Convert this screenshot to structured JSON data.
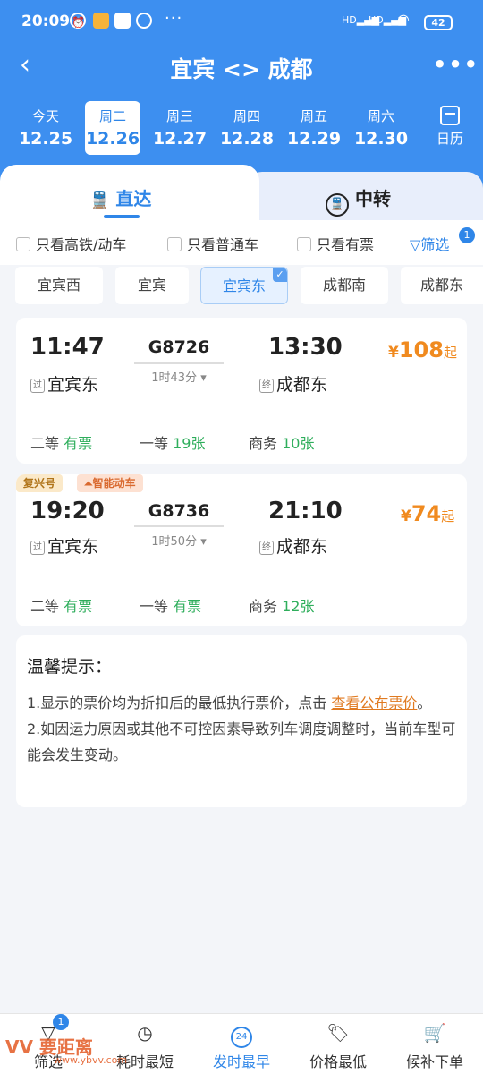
{
  "status": {
    "time": "20:09",
    "dots": "···",
    "hd1": "HD",
    "hd2": "HD",
    "battery": "42"
  },
  "header": {
    "back": "‹",
    "title": "宜宾 <> 成都",
    "more": "•••"
  },
  "dates": [
    {
      "wd": "今天",
      "d": "12.25"
    },
    {
      "wd": "周二",
      "d": "12.26"
    },
    {
      "wd": "周三",
      "d": "12.27"
    },
    {
      "wd": "周四",
      "d": "12.28"
    },
    {
      "wd": "周五",
      "d": "12.29"
    },
    {
      "wd": "周六",
      "d": "12.30"
    }
  ],
  "calendar_label": "日历",
  "tabs": {
    "direct": "直达",
    "transfer": "中转"
  },
  "filters": {
    "gaotie": "只看高铁/动车",
    "putong": "只看普通车",
    "youpiao": "只看有票",
    "shaixuan": "筛选",
    "shaixuan_badge": "1"
  },
  "stations": [
    "宜宾西",
    "宜宾",
    "宜宾东",
    "成都南",
    "成都东"
  ],
  "trains": [
    {
      "dep_time": "11:47",
      "train_no": "G8726",
      "duration": "1时43分",
      "arr_time": "13:30",
      "dep_tag": "过",
      "dep_station": "宜宾东",
      "arr_tag": "终",
      "arr_station": "成都东",
      "price_cur": "¥",
      "price": "108",
      "price_suffix": "起",
      "seats": [
        {
          "name": "二等",
          "avail": "有票"
        },
        {
          "name": "一等",
          "avail": "19张"
        },
        {
          "name": "商务",
          "avail": "10张"
        }
      ]
    },
    {
      "badge1": "复兴号",
      "badge2": "智能动车",
      "dep_time": "19:20",
      "train_no": "G8736",
      "duration": "1时50分",
      "arr_time": "21:10",
      "dep_tag": "过",
      "dep_station": "宜宾东",
      "arr_tag": "终",
      "arr_station": "成都东",
      "price_cur": "¥",
      "price": "74",
      "price_suffix": "起",
      "seats": [
        {
          "name": "二等",
          "avail": "有票"
        },
        {
          "name": "一等",
          "avail": "有票"
        },
        {
          "name": "商务",
          "avail": "12张"
        }
      ]
    }
  ],
  "tips": {
    "title": "温馨提示：",
    "p1_a": "1.显示的票价均为折扣后的最低执行票价，点击 ",
    "p1_link": "查看公布票价",
    "p1_b": "。",
    "p2": "2.如因运力原因或其他不可控因素导致列车调度调整时，当前车型可能会发生变动。"
  },
  "bottom": {
    "items": [
      {
        "label": "筛选",
        "icon": "filter-icon"
      },
      {
        "label": "耗时最短",
        "icon": "clock-icon"
      },
      {
        "label": "发时最早",
        "icon": "24h-icon"
      },
      {
        "label": "价格最低",
        "icon": "price-tag-icon"
      },
      {
        "label": "候补下单",
        "icon": "cart-icon"
      }
    ],
    "badge": "1",
    "clock_24": "24"
  },
  "watermark": {
    "logo": "VV 要距离",
    "sub": "www.ybvv.com"
  },
  "colors": {
    "primary": "#3d8ff0",
    "accent_price": "#f08a1f",
    "available": "#2fae5c"
  }
}
